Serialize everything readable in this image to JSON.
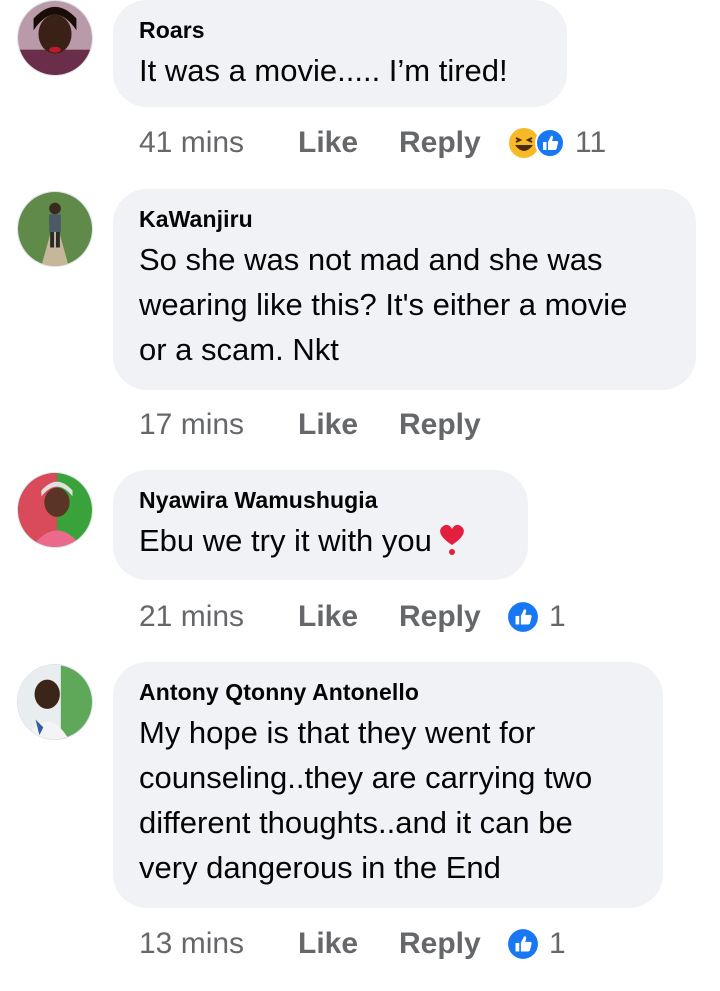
{
  "colors": {
    "bubble": "#f0f2f5",
    "text": "#050505",
    "meta": "#65676b",
    "like_blue": "#1877f2",
    "heart_red": "#e41e3f",
    "haha_yellow": "#f7b928"
  },
  "comments": [
    {
      "author": "Roars",
      "text": "It was a movie..... I’m tired!",
      "time": "41 mins",
      "like_label": "Like",
      "reply_label": "Reply",
      "reactions": [
        "haha-icon",
        "like-icon"
      ],
      "reaction_count": "11"
    },
    {
      "author": "KaWanjiru",
      "text": "So she was not mad and she was\nwearing like this? It's either a movie\nor a scam. Nkt",
      "time": "17 mins",
      "like_label": "Like",
      "reply_label": "Reply",
      "reactions": [],
      "reaction_count": ""
    },
    {
      "author": "Nyawira Wamushugia",
      "text": "Ebu we try it with you",
      "text_emoji": "heart-icon",
      "time": "21 mins",
      "like_label": "Like",
      "reply_label": "Reply",
      "reactions": [
        "like-icon"
      ],
      "reaction_count": "1"
    },
    {
      "author": "Antony Qtonny Antonello",
      "text": "My hope is that they went for\ncounseling..they are carrying two\ndifferent thoughts..and it can be\nvery dangerous in the End",
      "time": "13 mins",
      "like_label": "Like",
      "reply_label": "Reply",
      "reactions": [
        "like-icon"
      ],
      "reaction_count": "1"
    }
  ]
}
